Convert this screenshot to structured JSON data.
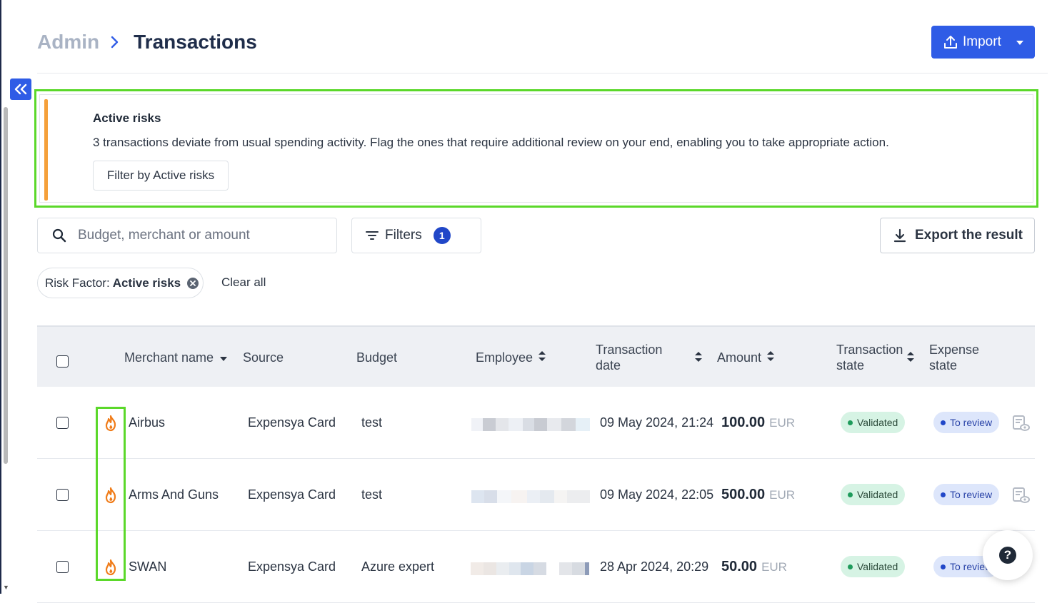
{
  "breadcrumb": {
    "parent": "Admin",
    "current": "Transactions"
  },
  "import_button": {
    "label": "Import"
  },
  "risk_banner": {
    "title": "Active risks",
    "message": "3 transactions deviate from usual spending activity. Flag the ones that require additional review on your end, enabling you to take appropriate action.",
    "filter_label": "Filter by Active risks"
  },
  "search": {
    "placeholder": "Budget, merchant or amount",
    "value": ""
  },
  "filters": {
    "label": "Filters",
    "count": "1"
  },
  "export": {
    "label": "Export the result"
  },
  "active_filter": {
    "key": "Risk Factor:",
    "value": "Active risks",
    "clear_label": "Clear all"
  },
  "table": {
    "columns": {
      "merchant": "Merchant name",
      "source": "Source",
      "budget": "Budget",
      "employee": "Employee",
      "date_line1": "Transaction",
      "date_line2": "date",
      "amount": "Amount",
      "tstate_line1": "Transaction",
      "tstate_line2": "state",
      "estate_line1": "Expense",
      "estate_line2": "state"
    },
    "rows": [
      {
        "merchant": "Airbus",
        "source": "Expensya Card",
        "budget": "test",
        "date": "09 May 2024, 21:24",
        "amount": "100.00",
        "currency": "EUR",
        "transaction_state": "Validated",
        "expense_state": "To review"
      },
      {
        "merchant": "Arms And Guns",
        "source": "Expensya Card",
        "budget": "test",
        "date": "09 May 2024, 22:05",
        "amount": "500.00",
        "currency": "EUR",
        "transaction_state": "Validated",
        "expense_state": "To review"
      },
      {
        "merchant": "SWAN",
        "source": "Expensya Card",
        "budget": "Azure expert",
        "date": "28 Apr 2024, 20:29",
        "amount": "50.00",
        "currency": "EUR",
        "transaction_state": "Validated",
        "expense_state": "To review"
      }
    ]
  },
  "help": {
    "label": "?"
  },
  "colors": {
    "primary": "#2f5ce6",
    "risk_accent": "#f5a03a",
    "highlight": "#5bd82a",
    "validated_bg": "#d6f3e4",
    "review_bg": "#dde6fb"
  },
  "icons": [
    "collapse-sidebar-icon",
    "chevron-right-icon",
    "upload-icon",
    "caret-down-icon",
    "search-icon",
    "filter-icon",
    "download-icon",
    "close-circle-icon",
    "sort-icon",
    "flame-icon",
    "receipt-view-icon",
    "help-icon"
  ]
}
